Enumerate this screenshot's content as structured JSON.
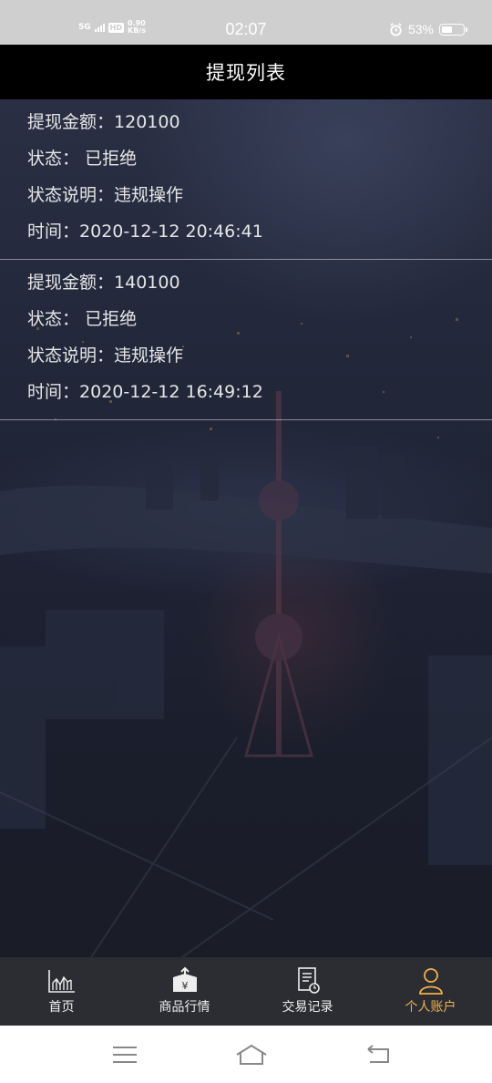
{
  "status_bar": {
    "network": "5G",
    "speed_value": "0.90",
    "speed_unit": "KB/s",
    "hd": "HD",
    "time": "02:07",
    "battery_percent": "53%",
    "battery_level": 0.53
  },
  "header": {
    "title": "提现列表"
  },
  "records": [
    {
      "amount_label": "提现金额：",
      "amount": "120100",
      "status_label": "状态：",
      "status": "已拒绝",
      "note_label": "状态说明：",
      "note": "违规操作",
      "time_label": "时间：",
      "time": "2020-12-12 20:46:41"
    },
    {
      "amount_label": "提现金额：",
      "amount": "140100",
      "status_label": "状态：",
      "status": "已拒绝",
      "note_label": "状态说明：",
      "note": "违规操作",
      "time_label": "时间：",
      "time": "2020-12-12 16:49:12"
    }
  ],
  "bottom_nav": {
    "items": [
      {
        "label": "首页",
        "icon": "chart-icon",
        "active": false
      },
      {
        "label": "商品行情",
        "icon": "yen-box-icon",
        "active": false
      },
      {
        "label": "交易记录",
        "icon": "document-clock-icon",
        "active": false
      },
      {
        "label": "个人账户",
        "icon": "user-icon",
        "active": true
      }
    ],
    "active_color": "#f0b04a"
  },
  "system_nav": {
    "menu_icon": "menu-icon",
    "home_icon": "home-icon",
    "back_icon": "back-icon"
  }
}
